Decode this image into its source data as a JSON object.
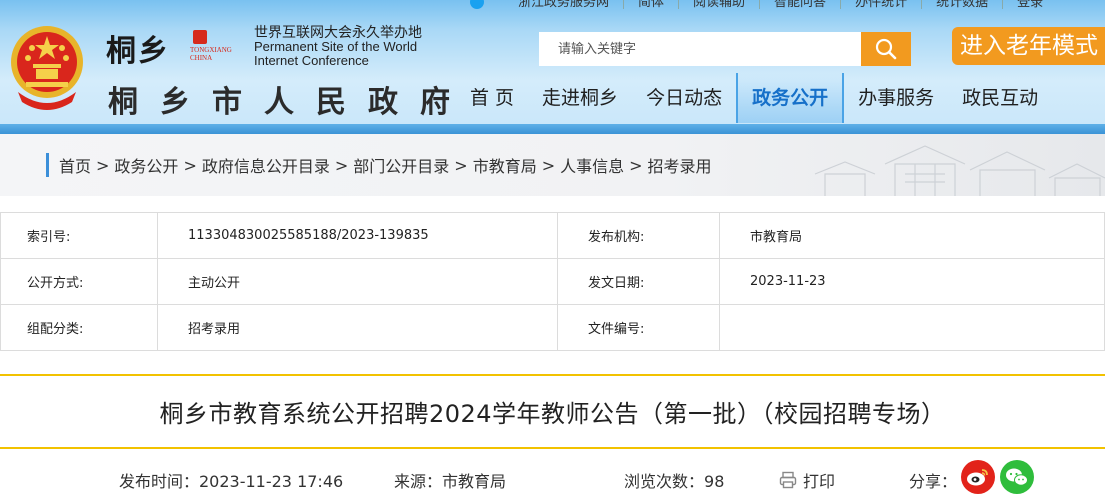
{
  "topbar": {
    "items": [
      "浙江政务服务网",
      "简体",
      "阅读辅助",
      "智能问答",
      "办件统计",
      "统计数据",
      "登录"
    ]
  },
  "header": {
    "site_calligraphy": "桐乡",
    "tongxiang_mark": "TONGXIANG CHINA",
    "wic_cn": "世界互联网大会永久举办地",
    "wic_en_line1": "Permanent Site of the World",
    "wic_en_line2": "Internet Conference",
    "gov_name": "桐乡市人民政府"
  },
  "search": {
    "placeholder": "请输入关键字"
  },
  "elder_mode_label": "进入老年模式",
  "nav": {
    "items": [
      {
        "label": "首 页"
      },
      {
        "label": "走进桐乡"
      },
      {
        "label": "今日动态"
      },
      {
        "label": "政务公开",
        "active": true
      },
      {
        "label": "办事服务"
      },
      {
        "label": "政民互动"
      }
    ]
  },
  "breadcrumb": [
    "首页",
    "政务公开",
    "政府信息公开目录",
    "部门公开目录",
    "市教育局",
    "人事信息",
    "招考录用"
  ],
  "breadcrumb_sep": ">",
  "meta": {
    "rows": [
      {
        "k1": "索引号:",
        "v1": "113304830025585188/2023-139835",
        "k2": "发布机构:",
        "v2": "市教育局"
      },
      {
        "k1": "公开方式:",
        "v1": "主动公开",
        "k2": "发文日期:",
        "v2": "2023-11-23"
      },
      {
        "k1": "组配分类:",
        "v1": "招考录用",
        "k2": "文件编号:",
        "v2": ""
      }
    ]
  },
  "article": {
    "title": "桐乡市教育系统公开招聘2024学年教师公告（第一批）（校园招聘专场）"
  },
  "info": {
    "publish_time": "发布时间：2023-11-23  17:46",
    "source": "来源：市教育局",
    "views_label": "浏览次数：",
    "views": "98",
    "print_label": "打印",
    "share_label": "分享："
  },
  "colors": {
    "accent_orange": "#f29a1f",
    "nav_active": "#1670c9",
    "title_border": "#f2c200",
    "weibo": "#e2231a",
    "wechat": "#2fbd3c"
  },
  "icons": {
    "search": "search-icon",
    "print": "printer-icon",
    "weibo": "weibo-icon",
    "wechat": "wechat-icon"
  }
}
